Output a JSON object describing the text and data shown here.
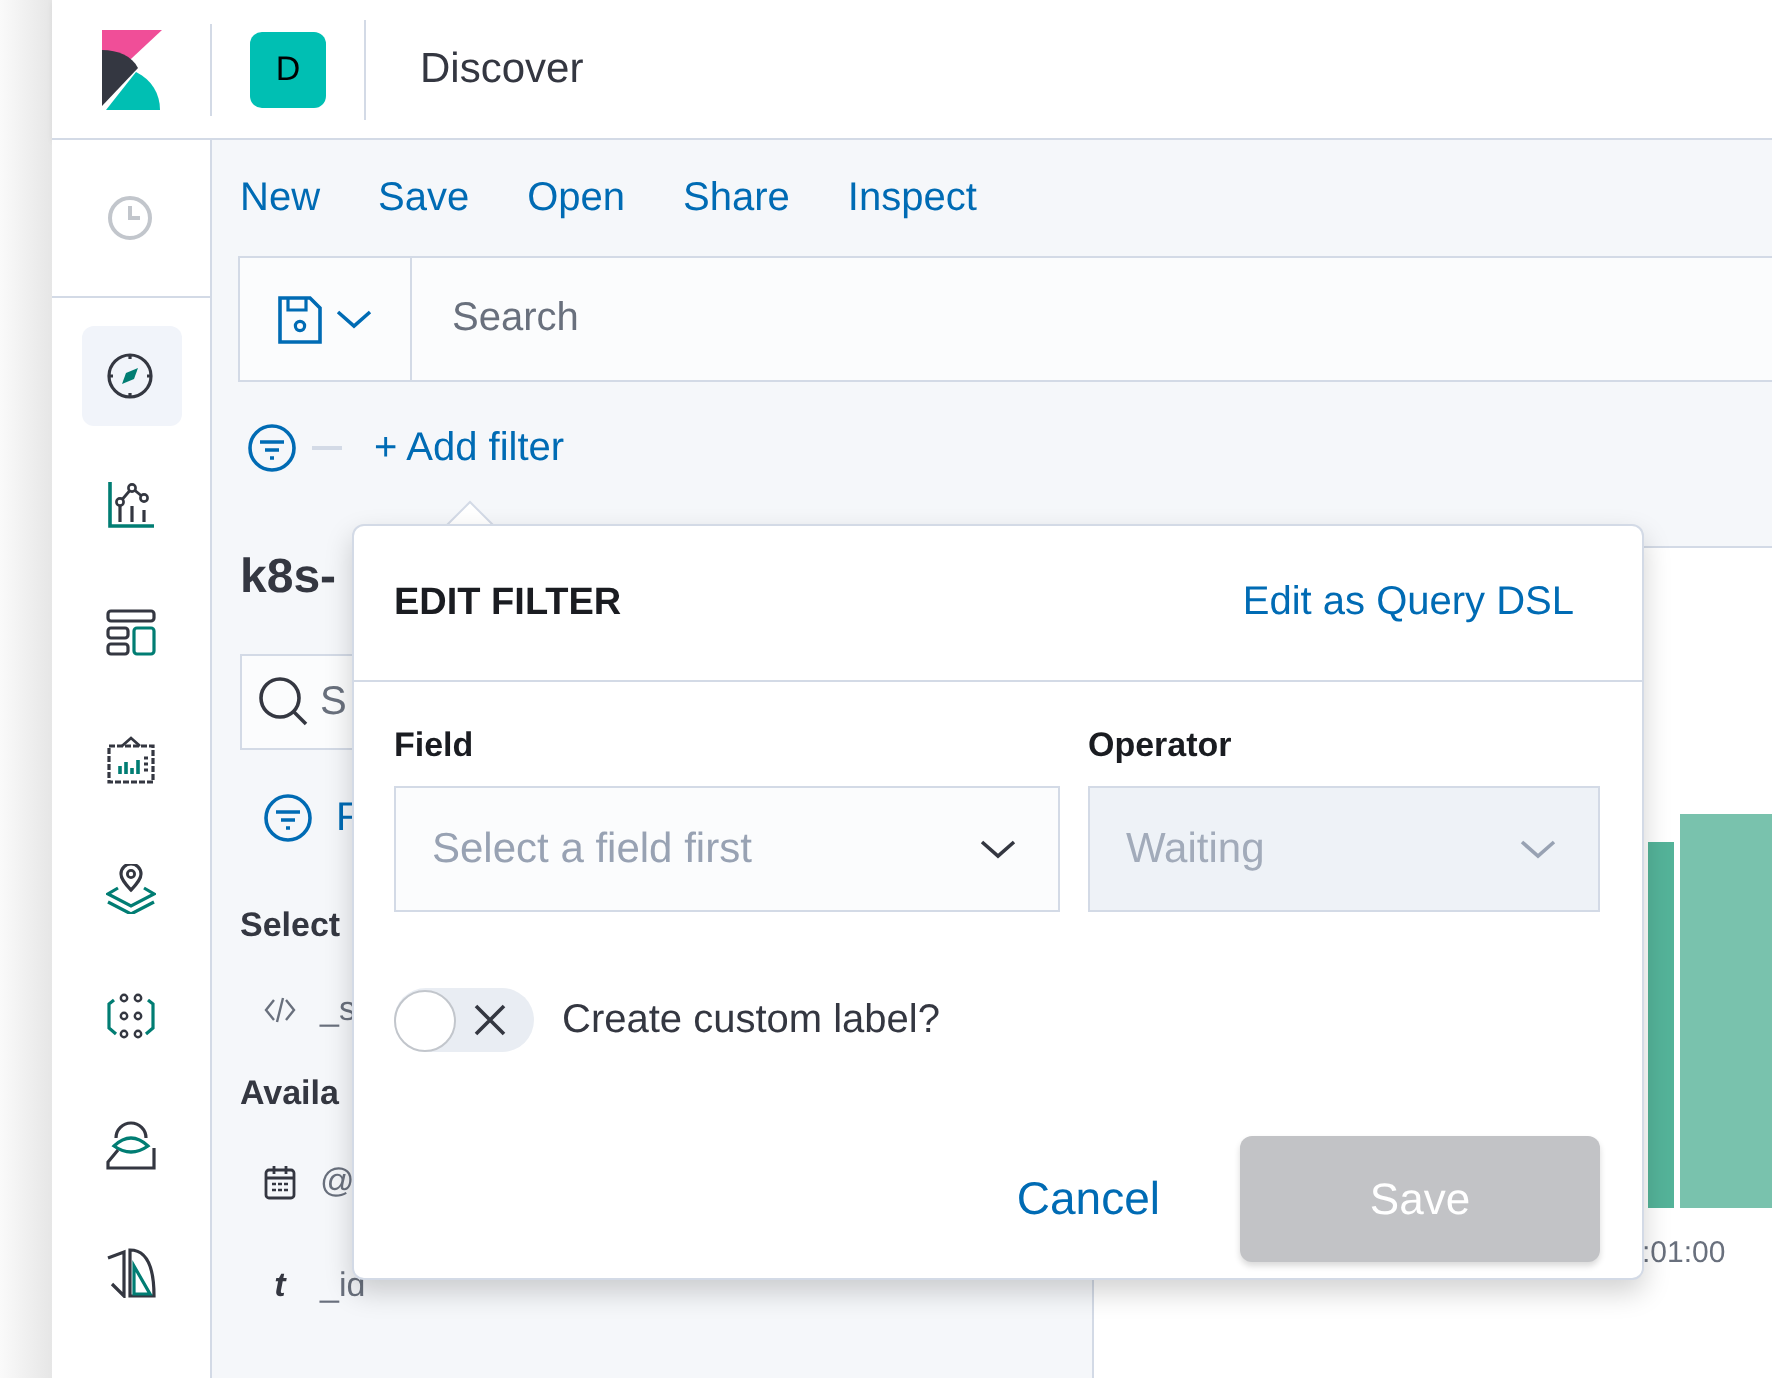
{
  "header": {
    "space_avatar": "D",
    "page_title": "Discover"
  },
  "nav": [
    {
      "kind": "clock",
      "selected": false
    },
    {
      "kind": "compass",
      "selected": true
    },
    {
      "kind": "chart",
      "selected": false
    },
    {
      "kind": "dashboard",
      "selected": false
    },
    {
      "kind": "canvas",
      "selected": false
    },
    {
      "kind": "map",
      "selected": false
    },
    {
      "kind": "dots",
      "selected": false
    },
    {
      "kind": "person",
      "selected": false
    },
    {
      "kind": "shapes",
      "selected": false
    }
  ],
  "top_menu": [
    "New",
    "Save",
    "Open",
    "Share",
    "Inspect"
  ],
  "query_bar": {
    "placeholder": "Search"
  },
  "filter_bar": {
    "add_filter": "+ Add filter"
  },
  "sidebar": {
    "index_pattern": "k8s-",
    "field_search_placeholder": "S",
    "filter_link": "F",
    "selected_heading": "Select",
    "selected_fields": [
      {
        "kind": "source",
        "name": "_s"
      }
    ],
    "available_heading": "Availa",
    "available_fields": [
      {
        "kind": "date",
        "name": "@"
      },
      {
        "kind": "string",
        "type_symbol": "t",
        "name": "_id"
      }
    ]
  },
  "chart": {
    "tick_label": ":01:00"
  },
  "edit_filter": {
    "title": "EDIT FILTER",
    "dsl_link": "Edit as Query DSL",
    "field": {
      "label": "Field",
      "placeholder": "Select a field first",
      "disabled": false
    },
    "operator": {
      "label": "Operator",
      "placeholder": "Waiting",
      "disabled": true
    },
    "custom_label": {
      "label": "Create custom label?",
      "on": false
    },
    "cancel": "Cancel",
    "save": {
      "label": "Save",
      "disabled": true
    }
  }
}
